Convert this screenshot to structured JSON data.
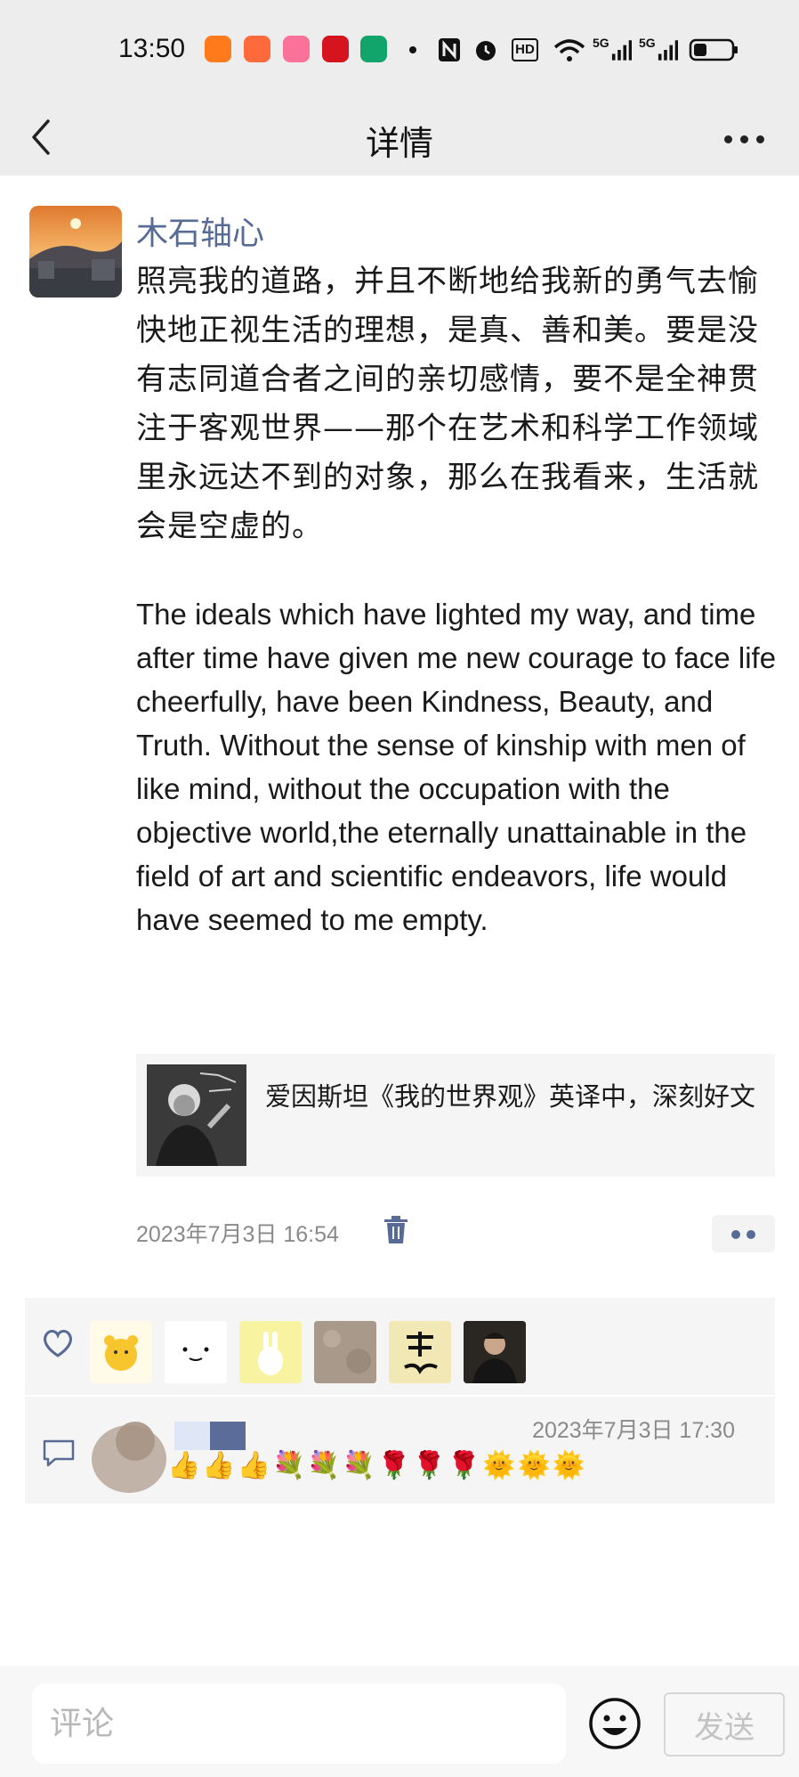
{
  "status_bar": {
    "time": "13:50",
    "indicators": [
      "taobao-app-icon",
      "app-grid-icon",
      "bilibili-app-icon",
      "study-app-icon",
      "green-app-icon",
      "dot",
      "nfc-icon",
      "alarm-icon",
      "hd-icon",
      "wifi-icon",
      "5g-signal-icon",
      "5g-signal-icon",
      "battery-icon"
    ],
    "hd_label": "HD",
    "signal_label": "5G"
  },
  "header": {
    "title": "详情"
  },
  "post": {
    "author": "木石轴心",
    "text_zh": "照亮我的道路，并且不断地给我新的勇气去愉快地正视生活的理想，是真、善和美。要是没有志同道合者之间的亲切感情，要不是全神贯注于客观世界——那个在艺术和科学工作领域里永远达不到的对象，那么在我看来，生活就会是空虚的。",
    "text_en": "The ideals which have lighted my way, and time after time have given me new courage to face life cheerfully, have been Kindness, Beauty, and Truth. Without the sense of kinship with men of like mind, without the occupation with the objective world,the eternally unattainable in the field of art and scientific endeavors, life would have seemed to me empty.",
    "link_card": {
      "title": "爱因斯坦《我的世界观》英译中，深刻好文"
    },
    "timestamp": "2023年7月3日 16:54"
  },
  "likes": {
    "icon": "heart-icon",
    "avatars": [
      "yellow-bear-avatar",
      "smile-face-avatar",
      "yellow-rabbit-avatar",
      "gray-texture-avatar",
      "calligraphy-avatar",
      "man-portrait-avatar"
    ]
  },
  "comments": [
    {
      "time": "2023年7月3日 17:30",
      "text": "👍👍👍💐💐💐🌹🌹🌹🌞🌞🌞"
    }
  ],
  "composer": {
    "placeholder": "评论",
    "send_label": "发送"
  },
  "colors": {
    "accent": "#576b95",
    "background_gray": "#ededed",
    "card_gray": "#f5f5f5"
  }
}
